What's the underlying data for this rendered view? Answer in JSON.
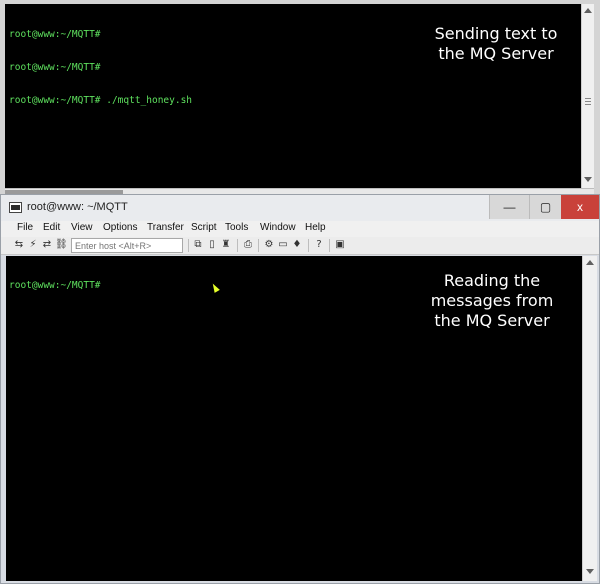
{
  "top_terminal": {
    "lines": [
      "root@www:~/MQTT#",
      "root@www:~/MQTT#",
      "root@www:~/MQTT# ./mqtt_honey.sh"
    ],
    "caption": "Sending text to the MQ Server"
  },
  "bottom_window": {
    "title": "root@www: ~/MQTT",
    "controls": {
      "minimize": "—",
      "maximize": "▢",
      "close": "x"
    },
    "menu": [
      "File",
      "Edit",
      "View",
      "Options",
      "Transfer",
      "Script",
      "Tools",
      "Window",
      "Help"
    ],
    "toolbar": {
      "host_placeholder": "Enter host <Alt+R>",
      "icons": [
        "connect-icon",
        "quick-connect-icon",
        "reconnect-icon",
        "disconnect-icon",
        "copy-icon",
        "paste-icon",
        "find-icon",
        "print-icon",
        "session-options-icon",
        "keymap-icon",
        "sftp-icon",
        "help-icon",
        "about-icon"
      ]
    },
    "terminal": {
      "lines": [
        "root@www:~/MQTT#"
      ],
      "caption": "Reading the messages from the MQ Server"
    }
  },
  "colors": {
    "terminal_bg": "#000000",
    "prompt_text": "#5ee05e",
    "caption_text": "#ffffff",
    "close_button": "#c9413a"
  }
}
